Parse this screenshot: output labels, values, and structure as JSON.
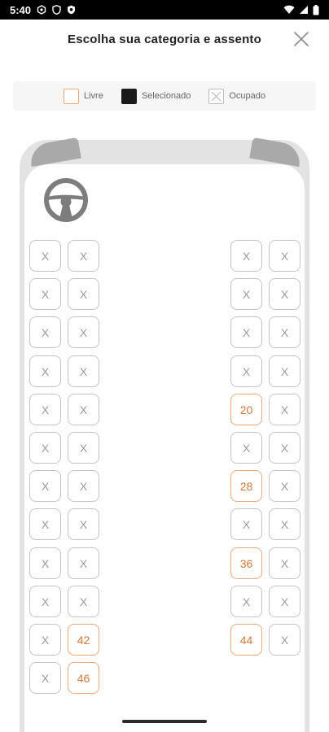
{
  "status_bar": {
    "time": "5:40"
  },
  "header": {
    "title": "Escolha sua categoria e assento"
  },
  "legend": {
    "free": "Livre",
    "selected": "Selecionado",
    "occupied": "Ocupado"
  },
  "colors": {
    "accent": "#d2793a",
    "free_border": "#e8a97a",
    "occupied_border": "#c4c4c4",
    "bus_body": "#e3e3e3"
  },
  "seat_rows": [
    {
      "left": [
        "X",
        "X"
      ],
      "right": [
        "X",
        "X"
      ]
    },
    {
      "left": [
        "X",
        "X"
      ],
      "right": [
        "X",
        "X"
      ]
    },
    {
      "left": [
        "X",
        "X"
      ],
      "right": [
        "X",
        "X"
      ]
    },
    {
      "left": [
        "X",
        "X"
      ],
      "right": [
        "X",
        "X"
      ]
    },
    {
      "left": [
        "X",
        "X"
      ],
      "right": [
        "20",
        "X"
      ]
    },
    {
      "left": [
        "X",
        "X"
      ],
      "right": [
        "X",
        "X"
      ]
    },
    {
      "left": [
        "X",
        "X"
      ],
      "right": [
        "28",
        "X"
      ]
    },
    {
      "left": [
        "X",
        "X"
      ],
      "right": [
        "X",
        "X"
      ]
    },
    {
      "left": [
        "X",
        "X"
      ],
      "right": [
        "36",
        "X"
      ]
    },
    {
      "left": [
        "X",
        "X"
      ],
      "right": [
        "X",
        "X"
      ]
    },
    {
      "left": [
        "X",
        "42"
      ],
      "right": [
        "44",
        "X"
      ]
    },
    {
      "left": [
        "X",
        "46"
      ],
      "right": []
    }
  ]
}
